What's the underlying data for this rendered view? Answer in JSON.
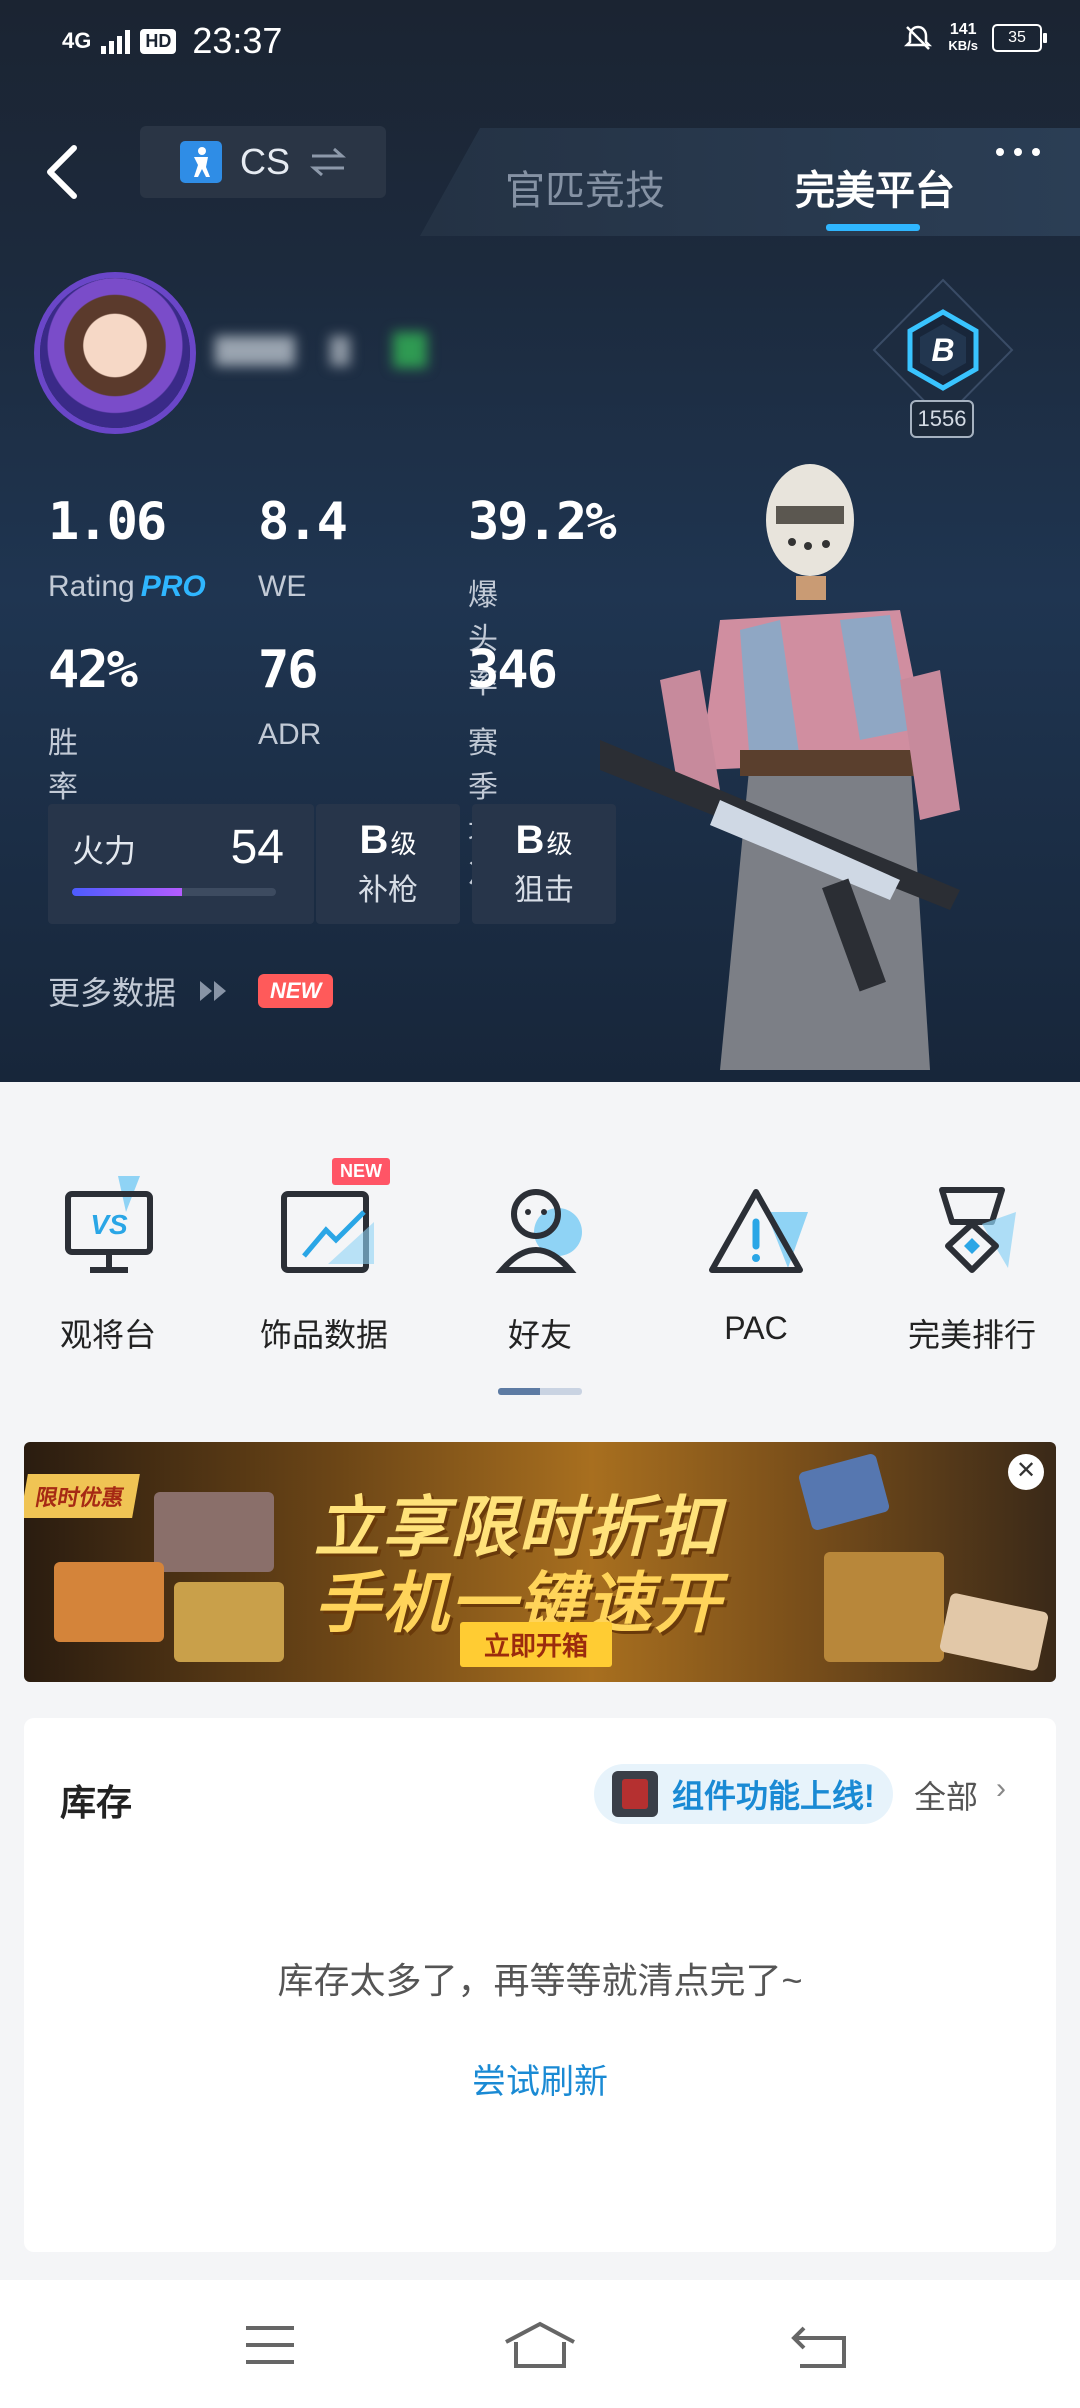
{
  "status_bar": {
    "network": "4G",
    "hd": "HD",
    "time": "23:37",
    "speed_value": "141",
    "speed_unit": "KB/s",
    "battery": "35"
  },
  "nav": {
    "game": "CS",
    "tabs": [
      "官匹竞技",
      "完美平台"
    ],
    "active_tab": "完美平台"
  },
  "profile": {
    "rank_letter": "B",
    "rank_score": "1556"
  },
  "stats": [
    {
      "value": "1.06",
      "label": "Rating",
      "pro": "PRO"
    },
    {
      "value": "8.4",
      "label": "WE"
    },
    {
      "value": "39.2%",
      "label": "爆头率"
    },
    {
      "value": "42%",
      "label": "胜率"
    },
    {
      "value": "76",
      "label": "ADR"
    },
    {
      "value": "346",
      "label": "赛季场次"
    }
  ],
  "firepower": {
    "label": "火力",
    "value": "54",
    "progress": 0.54
  },
  "grades": [
    {
      "grade": "B",
      "suffix": "级",
      "label": "补枪"
    },
    {
      "grade": "B",
      "suffix": "级",
      "label": "狙击"
    }
  ],
  "more_data": {
    "label": "更多数据",
    "badge": "NEW"
  },
  "shortcuts": [
    {
      "label": "观将台",
      "icon": "vs-monitor-icon",
      "icon_text": "VS"
    },
    {
      "label": "饰品数据",
      "icon": "chart-icon",
      "badge": "NEW"
    },
    {
      "label": "好友",
      "icon": "friends-icon"
    },
    {
      "label": "PAC",
      "icon": "warning-icon"
    },
    {
      "label": "完美排行",
      "icon": "medal-icon"
    }
  ],
  "banner": {
    "tag": "限时优惠",
    "line1": "立享限时折扣",
    "line2": "手机一键速开",
    "button": "立即开箱",
    "close": "✕"
  },
  "inventory": {
    "title": "库存",
    "widget_text": "组件功能上线!",
    "all_label": "全部",
    "empty_text": "库存太多了，再等等就清点完了~",
    "refresh": "尝试刷新"
  },
  "colors": {
    "accent": "#2fb6ff",
    "hero_bg": "#1f3551",
    "new_badge": "#ff5a5a",
    "link": "#1a8ad4"
  }
}
